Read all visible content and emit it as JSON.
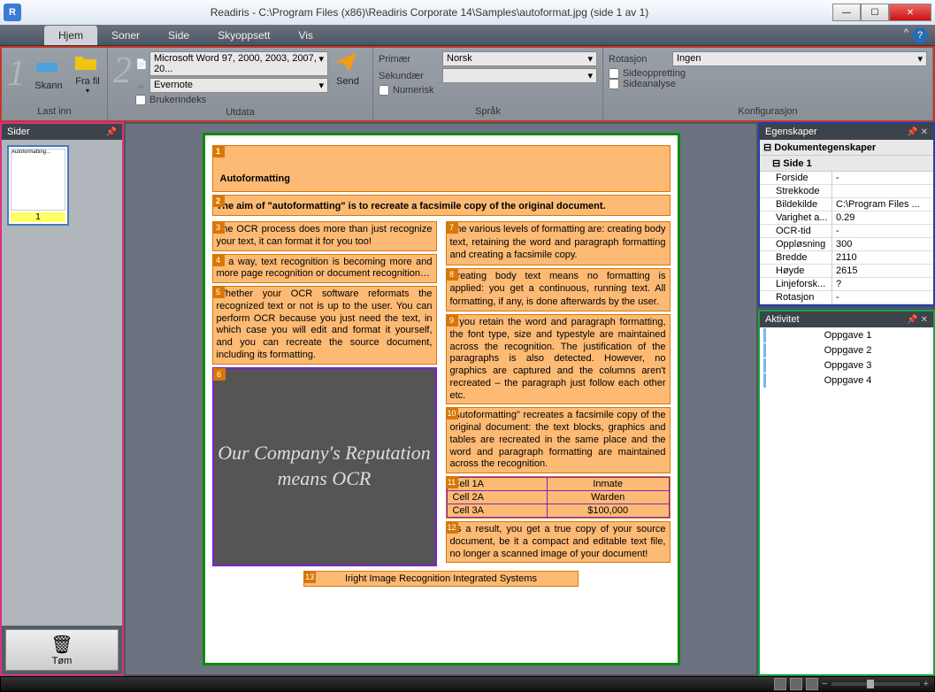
{
  "title": "Readiris - C:\\Program Files (x86)\\Readiris Corporate 14\\Samples\\autoformat.jpg (side 1 av 1)",
  "tabs": {
    "hjem": "Hjem",
    "soner": "Soner",
    "side": "Side",
    "skyoppsett": "Skyoppsett",
    "vis": "Vis"
  },
  "ribbon": {
    "g1": {
      "skann": "Skann",
      "frafil": "Fra fil",
      "label": "Last inn"
    },
    "g2": {
      "format": "Microsoft Word 97, 2000, 2003, 2007, 20...",
      "dest": "Evernote",
      "userindex": "Brukerindeks",
      "send": "Send",
      "label": "Utdata"
    },
    "g3": {
      "primary_lbl": "Primær",
      "primary_val": "Norsk",
      "secondary_lbl": "Sekundær",
      "secondary_val": "",
      "numeric": "Numerisk",
      "label": "Språk"
    },
    "g4": {
      "rotation_lbl": "Rotasjon",
      "rotation_val": "Ingen",
      "deskew": "Sideoppretting",
      "analysis": "Sideanalyse",
      "label": "Konfigurasjon"
    }
  },
  "left": {
    "title": "Sider",
    "thumb_num": "1",
    "empty": "Tøm"
  },
  "doc": {
    "h1": "Autoformatting",
    "h2": "The aim of \"autoformatting\" is to recreate a facsimile copy of the original document.",
    "z3": "The OCR process does more than just recognize your text, it can format it for you too!",
    "z4": "In a way, text recognition is becoming more and more page recognition or document recognition…",
    "z5": "Whether your OCR software reformats the recognized text or not is up to the user. You can perform OCR because you just need the text, in which case you will edit and format it yourself, and you can recreate the source document, including its formatting.",
    "z6": "Our Company's Reputation means OCR",
    "z7": "The various levels of formatting are: creating body text, retaining the word and paragraph formatting and creating a facsimile copy.",
    "z8": "Creating body text means no formatting is applied: you get a continuous, running text. All formatting, if any, is done afterwards by the user.",
    "z9": "If you retain the word and paragraph formatting, the font type, size and typestyle are maintained across the recognition. The justification of the paragraphs is also detected. However, no graphics are captured and the columns aren't recreated – the paragraph just follow each other etc.",
    "z10": "\"Autoformatting\" recreates a facsimile copy of the original document: the text blocks, graphics and tables are recreated in the same place and the word and paragraph formatting are maintained across the recognition.",
    "z12": "As a result, you get a true copy of your source document, be it a compact and editable text file, no longer a scanned image of your document!",
    "z13": "Iright Image Recognition Integrated Systems",
    "table": {
      "r1c1": "Cell 1A",
      "r1c2": "Inmate",
      "r2c1": "Cell 2A",
      "r2c2": "Warden",
      "r3c1": "Cell 3A",
      "r3c2": "$100,000"
    }
  },
  "props": {
    "title": "Egenskaper",
    "root": "Dokumentegenskaper",
    "page": "Side 1",
    "rows": {
      "forside_k": "Forside",
      "forside_v": "-",
      "strekkode_k": "Strekkode",
      "strekkode_v": "",
      "bildekilde_k": "Bildekilde",
      "bildekilde_v": "C:\\Program Files ...",
      "varighet_k": "Varighet a...",
      "varighet_v": "0.29",
      "ocrtid_k": "OCR-tid",
      "ocrtid_v": "-",
      "opplosning_k": "Oppløsning",
      "opplosning_v": "300",
      "bredde_k": "Bredde",
      "bredde_v": "2110",
      "hoyde_k": "Høyde",
      "hoyde_v": "2615",
      "linje_k": "Linjeforsk...",
      "linje_v": "?",
      "rotasjon_k": "Rotasjon",
      "rotasjon_v": "-"
    }
  },
  "activity": {
    "title": "Aktivitet",
    "items": {
      "i1": "Oppgave 1",
      "i2": "Oppgave 2",
      "i3": "Oppgave 3",
      "i4": "Oppgave 4"
    }
  }
}
